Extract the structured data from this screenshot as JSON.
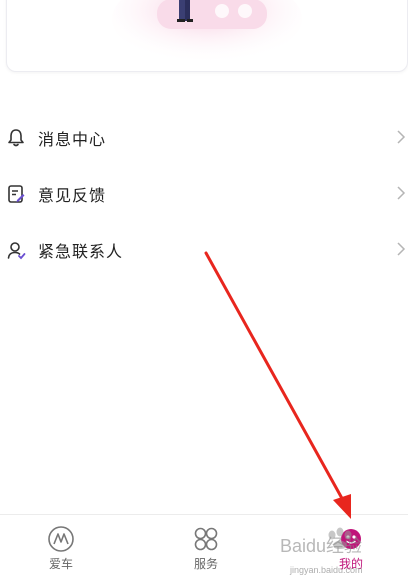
{
  "menu": {
    "items": [
      {
        "label": "消息中心",
        "icon": "bell-icon"
      },
      {
        "label": "意见反馈",
        "icon": "feedback-icon"
      },
      {
        "label": "紧急联系人",
        "icon": "contact-icon"
      }
    ]
  },
  "tabbar": {
    "tabs": [
      {
        "label": "爱车",
        "icon": "car-brand-icon",
        "active": false
      },
      {
        "label": "服务",
        "icon": "services-grid-icon",
        "active": false
      },
      {
        "label": "我的",
        "icon": "profile-icon",
        "active": true
      }
    ]
  },
  "watermark": {
    "text": "Baidu经验",
    "subtext": "jingyan.baidu.com"
  },
  "colors": {
    "accent": "#c0147a",
    "arrow": "#e8261e",
    "text": "#222222",
    "muted": "#666666"
  }
}
